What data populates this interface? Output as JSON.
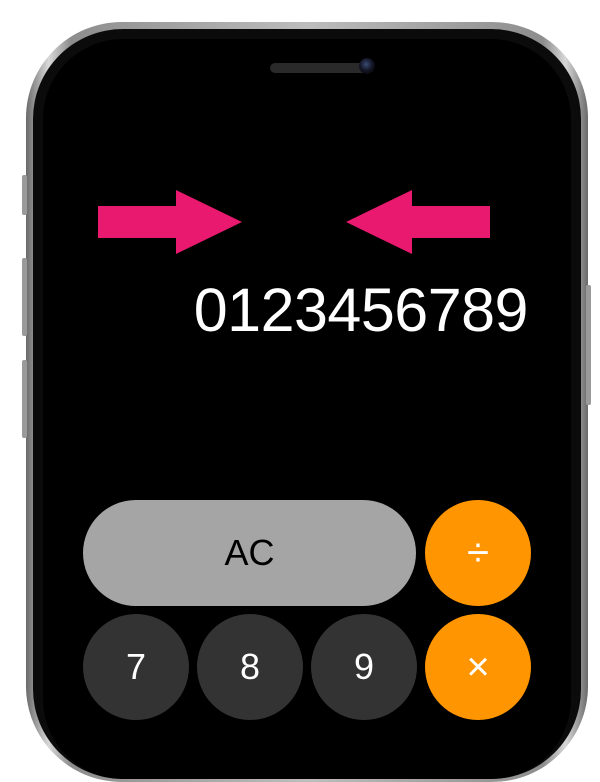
{
  "display": {
    "value": "0123456789"
  },
  "keypad": {
    "clear": "AC",
    "divide": "÷",
    "seven": "7",
    "eight": "8",
    "nine": "9",
    "multiply": "×"
  },
  "colors": {
    "arrow": "#e8196e",
    "function_key": "#a5a5a5",
    "number_key": "#333333",
    "operator_key": "#ff9500"
  }
}
